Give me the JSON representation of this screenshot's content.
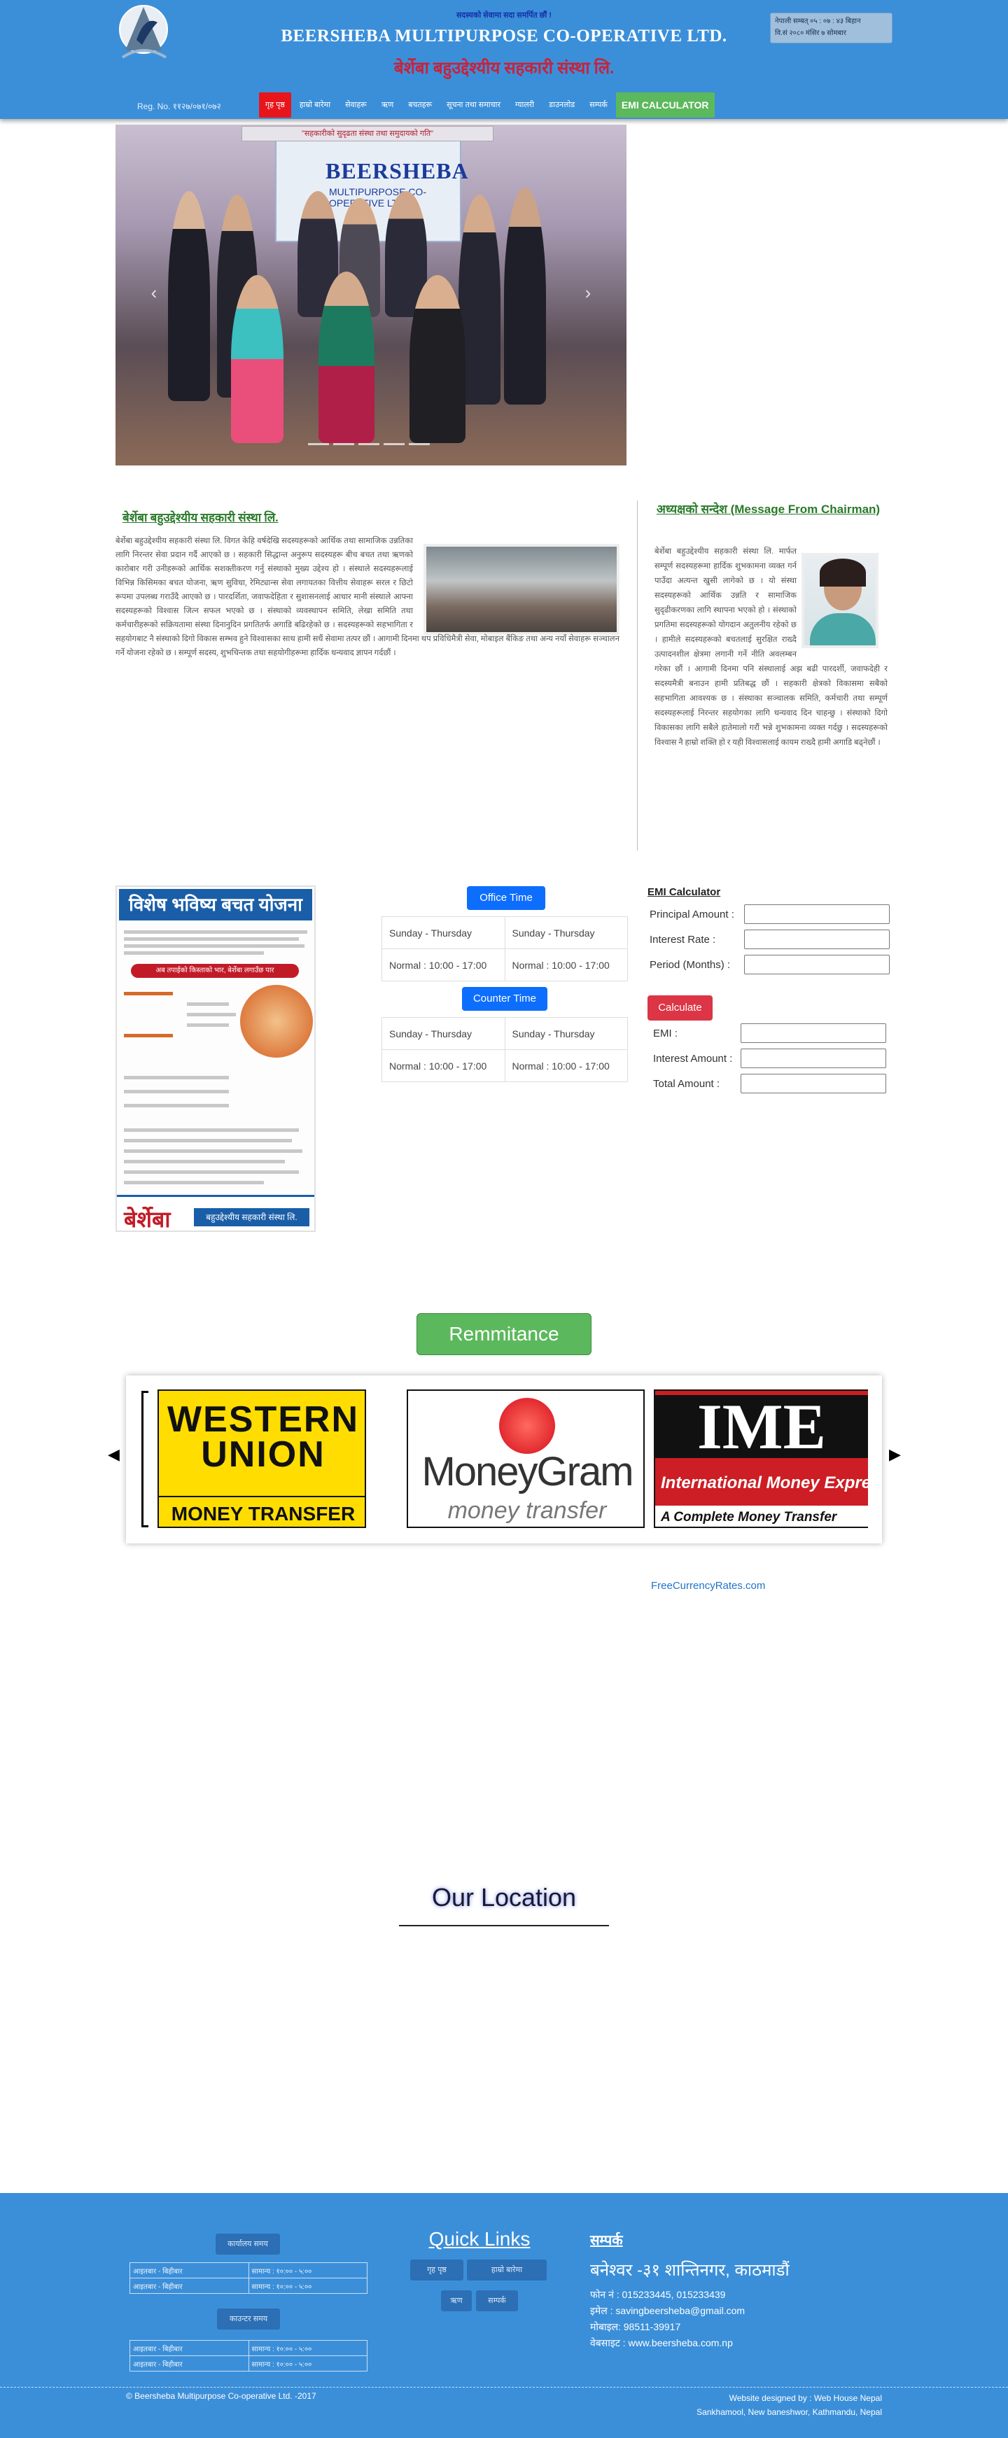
{
  "header": {
    "slogan": "सदस्यको सेवामा सदा समर्पित छौं !",
    "title": "BEERSHEBA MULTIPURPOSE CO-OPERATIVE LTD.",
    "title_np": "बेर्शेबा बहुउद्देश्यीय सहकारी संस्था लि.",
    "date_line1": "नेपाली सम्बत् ०५ : ०७ : ४३ बिहान",
    "date_line2": "वि.सं २०८० मंसिर ७ सोमबार",
    "reg": "Reg. No. ११२७/०७१/०७२"
  },
  "nav": [
    {
      "label": "गृह पृष्ठ",
      "active": true
    },
    {
      "label": "हाम्रो बारेमा"
    },
    {
      "label": "सेवाहरू"
    },
    {
      "label": "ऋण"
    },
    {
      "label": "बचतहरू"
    },
    {
      "label": "सूचना तथा समाचार"
    },
    {
      "label": "ग्यालरी"
    },
    {
      "label": "डाउनलोड"
    },
    {
      "label": "सम्पर्क"
    },
    {
      "label": "EMI CALCULATOR",
      "emi": true
    }
  ],
  "carousel": {
    "banner_top": "\"सहकारीको सुदृढता संस्था तथा समुदायको गति\"",
    "banner_name": "BEERSHEBA",
    "banner_sub": "MULTIPURPOSE CO-OPERATIVE LTD.",
    "prev_icon": "chevron-left-icon",
    "next_icon": "chevron-right-icon"
  },
  "about": {
    "title": "बेर्शेबा बहुउद्देश्यीय सहकारी संस्था लि.",
    "text": "बेर्शेबा बहुउद्देश्यीय सहकारी संस्था लि. विगत केहि वर्षदेखि सदस्यहरूको आर्थिक तथा सामाजिक उन्नतिका लागि निरन्तर सेवा प्रदान गर्दै आएको छ । सहकारी सिद्धान्त अनुरूप सदस्यहरू बीच बचत तथा ऋणको कारोबार गरी उनीहरूको आर्थिक सशक्तीकरण गर्नु संस्थाको मुख्य उद्देश्य हो । संस्थाले सदस्यहरूलाई विभिन्न किसिमका बचत योजना, ऋण सुविधा, रेमिट्यान्स सेवा लगायतका वित्तीय सेवाहरू सरल र छिटो रूपमा उपलब्ध गराउँदै आएको छ । पारदर्शिता, जवाफदेहिता र सुशासनलाई आधार मानी संस्थाले आफ्ना सदस्यहरूको विश्वास जित्न सफल भएको छ । संस्थाको व्यवस्थापन समिति, लेखा समिति तथा कर्मचारीहरूको सक्रियतामा संस्था दिनानुदिन प्रगतितर्फ अगाडि बढिरहेको छ । सदस्यहरूको सहभागिता र सहयोगबाट नै संस्थाको दिगो विकास सम्भव हुने विश्वासका साथ हामी सधैं सेवामा तत्पर छौं । आगामी दिनमा थप प्रविधिमैत्री सेवा, मोबाइल बैंकिङ तथा अन्य नयाँ सेवाहरू सञ्चालन गर्ने योजना रहेको छ । सम्पूर्ण सदस्य, शुभचिन्तक तथा सहयोगीहरूमा हार्दिक धन्यवाद ज्ञापन गर्दछौं ।"
  },
  "message": {
    "title": "अध्यक्षको सन्देश (Message From Chairman)",
    "text": "बेर्शेबा बहुउद्देश्यीय सहकारी संस्था लि. मार्फत सम्पूर्ण सदस्यहरूमा हार्दिक शुभकामना व्यक्त गर्न पाउँदा अत्यन्त खुसी लागेको छ । यो संस्था सदस्यहरूको आर्थिक उन्नति र सामाजिक सुदृढीकरणका लागि स्थापना भएको हो । संस्थाको प्रगतिमा सदस्यहरूको योगदान अतुलनीय रहेको छ । हामीले सदस्यहरूको बचतलाई सुरक्षित राख्दै उत्पादनशील क्षेत्रमा लगानी गर्ने नीति अवलम्बन गरेका छौं । आगामी दिनमा पनि संस्थालाई अझ बढी पारदर्शी, जवाफदेही र सदस्यमैत्री बनाउन हामी प्रतिबद्ध छौं । सहकारी क्षेत्रको विकासमा सबैको सहभागिता आवश्यक छ । संस्थाका सञ्चालक समिति, कर्मचारी तथा सम्पूर्ण सदस्यहरूलाई निरन्तर सहयोगका लागि धन्यवाद दिन चाहन्छु । संस्थाको दिगो विकासका लागि सबैले हातेमालो गरौं भन्ने शुभकामना व्यक्त गर्दछु । सदस्यहरूको विश्वास नै हाम्रो शक्ति हो र यही विश्वासलाई कायम राख्दै हामी अगाडि बढ्नेछौं ।"
  },
  "poster": {
    "heading": "विशेष भविष्य बचत योजना",
    "tagline": "अब तपाईको किस्ताको भार, बेर्शेबा लगाउँछ पार",
    "brand": "बेर्शेबा",
    "brand_sub": "बहुउद्देश्यीय सहकारी संस्था लि."
  },
  "office_time": {
    "label": "Office Time",
    "rows": [
      [
        "Sunday - Thursday",
        "Sunday - Thursday"
      ],
      [
        "Normal : 10:00 - 17:00",
        "Normal : 10:00 - 17:00"
      ]
    ]
  },
  "counter_time": {
    "label": "Counter Time",
    "rows": [
      [
        "Sunday - Thursday",
        "Sunday - Thursday"
      ],
      [
        "Normal : 10:00 - 17:00",
        "Normal : 10:00 - 17:00"
      ]
    ]
  },
  "emi": {
    "title": "EMI Calculator",
    "principal": "Principal Amount :",
    "rate": "Interest Rate :",
    "period": "Period (Months) :",
    "calculate": "Calculate",
    "emi": "EMI :",
    "interest_amount": "Interest Amount :",
    "total_amount": "Total Amount :"
  },
  "remittance": {
    "button": "Remmitance",
    "wu_1": "WESTERN",
    "wu_2": "UNION",
    "wu_3": "MONEY TRANSFER",
    "mg_1": "MoneyGram",
    "mg_2": "money transfer",
    "ime_1": "IME",
    "ime_2": "International Money Express",
    "ime_3": "A Complete Money Transfer Solution",
    "fcr": "FreeCurrencyRates.com"
  },
  "location": {
    "title": "Our Location"
  },
  "footer": {
    "office_label": "कार्यालय समय",
    "counter_label": "काउन्टर समय",
    "office_rows": [
      [
        "आइतबार - बिहीबार",
        "सामान्य : १०:०० - ५:००"
      ],
      [
        "आइतबार - बिहीबार",
        "सामान्य : १०:०० - ५:००"
      ]
    ],
    "counter_rows": [
      [
        "आइतबार - बिहीबार",
        "सामान्य : १०:०० - ५:००"
      ],
      [
        "आइतबार - बिहीबार",
        "सामान्य : १०:०० - ५:००"
      ]
    ],
    "quick_links": "Quick Links",
    "ql_items": [
      "गृह पृष्ठ",
      "हाम्रो बारेमा",
      "ऋण",
      "सम्पर्क"
    ],
    "contact_title": "सम्पर्क",
    "contact_name": "बनेश्वर -३१ शान्तिनगर, काठमाडौं",
    "phone": "फोन नं : 015233445, 015233439",
    "email": "इमेल : savingbeersheba@gmail.com",
    "mobile": "मोबाइल: 98511-39917",
    "web": "वेबसाइट : www.beersheba.com.np",
    "copyright": "© Beersheba Multipurpose Co-operative Ltd. -2017",
    "designed_by": "Website designed by : Web House Nepal",
    "address": "Sankhamool, New baneshwor, Kathmandu, Nepal"
  }
}
